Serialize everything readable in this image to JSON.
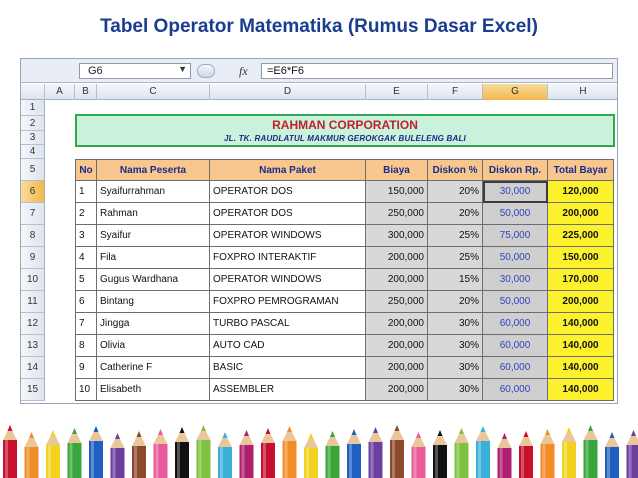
{
  "slide": {
    "title": "Tabel Operator Matematika (Rumus Dasar Excel)"
  },
  "formula_bar": {
    "name_box": "G6",
    "fx_label": "fx",
    "formula": "=E6*F6"
  },
  "columns": [
    "A",
    "B",
    "C",
    "D",
    "E",
    "F",
    "G",
    "H"
  ],
  "selected_column": "G",
  "rows": [
    "1",
    "2",
    "3",
    "4",
    "5",
    "6",
    "7",
    "8",
    "9",
    "10",
    "11",
    "12",
    "13",
    "14",
    "15"
  ],
  "selected_row": "6",
  "banner": {
    "company": "RAHMAN CORPORATION",
    "address": "JL. TK. RAUDLATUL MAKMUR GEROKGAK BULELENG BALI",
    "border_color": "#2fa84f",
    "fill_color": "#c9f1dc"
  },
  "table": {
    "headers": [
      "No",
      "Nama Peserta",
      "Nama Paket",
      "Biaya",
      "Diskon %",
      "Diskon Rp.",
      "Total Bayar"
    ],
    "rows": [
      [
        "1",
        "Syaifurrahman",
        "OPERATOR DOS",
        "150,000",
        "20%",
        "30,000",
        "120,000"
      ],
      [
        "2",
        "Rahman",
        "OPERATOR DOS",
        "250,000",
        "20%",
        "50,000",
        "200,000"
      ],
      [
        "3",
        "Syaifur",
        "OPERATOR WINDOWS",
        "300,000",
        "25%",
        "75,000",
        "225,000"
      ],
      [
        "4",
        "Fila",
        "FOXPRO INTERAKTIF",
        "200,000",
        "25%",
        "50,000",
        "150,000"
      ],
      [
        "5",
        "Gugus Wardhana",
        "OPERATOR WINDOWS",
        "200,000",
        "15%",
        "30,000",
        "170,000"
      ],
      [
        "6",
        "Bintang",
        "FOXPRO PEMROGRAMAN",
        "250,000",
        "20%",
        "50,000",
        "200,000"
      ],
      [
        "7",
        "Jingga",
        "TURBO PASCAL",
        "200,000",
        "30%",
        "60,000",
        "140,000"
      ],
      [
        "8",
        "Olivia",
        "AUTO CAD",
        "200,000",
        "30%",
        "60,000",
        "140,000"
      ],
      [
        "9",
        "Catherine F",
        "BASIC",
        "200,000",
        "30%",
        "60,000",
        "140,000"
      ],
      [
        "10",
        "Elisabeth",
        "ASSEMBLER",
        "200,000",
        "30%",
        "60,000",
        "140,000"
      ]
    ],
    "header_color": "#f7c78d",
    "total_color": "#fbf22d",
    "discount_text_color": "#2f45c0"
  },
  "decoration": {
    "pencil_colors": [
      "#c8102e",
      "#f28c28",
      "#f2d21e",
      "#3aa53a",
      "#1f5fbf",
      "#6b3fa0",
      "#8b4a2b",
      "#e85a9a",
      "#111111",
      "#7fc241",
      "#3ab0d8",
      "#b01e6e"
    ]
  }
}
